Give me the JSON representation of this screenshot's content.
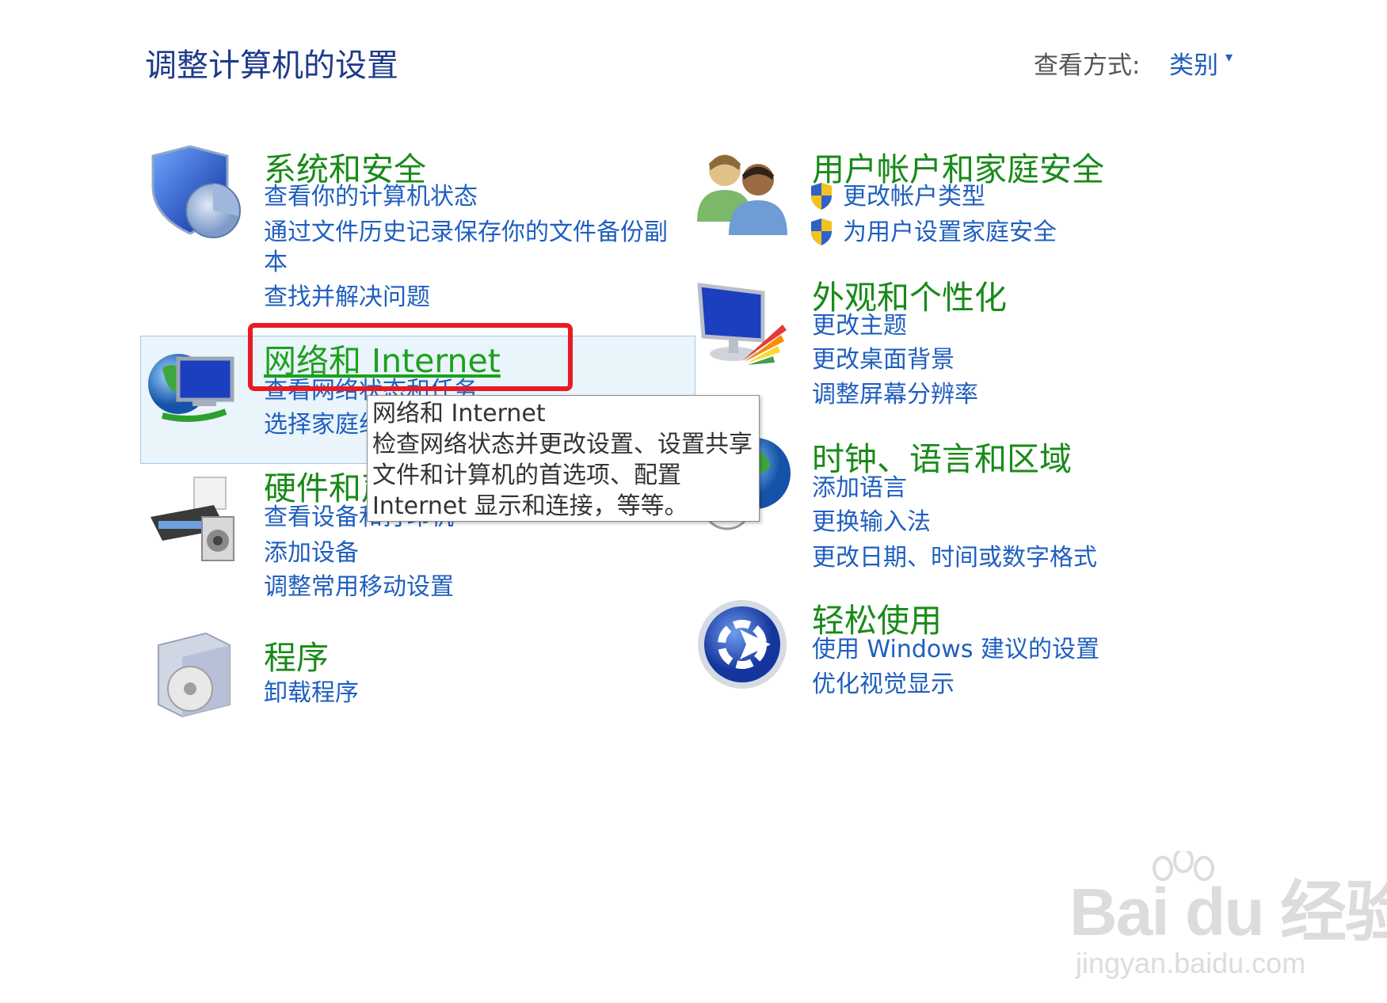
{
  "header": {
    "title": "调整计算机的设置",
    "view_label": "查看方式:",
    "view_value": "类别"
  },
  "categories": {
    "system_security": {
      "title": "系统和安全",
      "links": [
        "查看你的计算机状态",
        "通过文件历史记录保存你的文件备份副",
        "本",
        "查找并解决问题"
      ]
    },
    "network_internet": {
      "title": "网络和 Internet",
      "links": [
        "查看网络状态和任务",
        "选择家庭组"
      ]
    },
    "hardware_sound": {
      "title": "硬件和声音",
      "links": [
        "查看设备和打印机",
        "添加设备",
        "调整常用移动设置"
      ]
    },
    "programs": {
      "title": "程序",
      "links": [
        "卸载程序"
      ]
    },
    "user_accounts": {
      "title": "用户帐户和家庭安全",
      "links": [
        "更改帐户类型",
        "为用户设置家庭安全"
      ]
    },
    "appearance": {
      "title": "外观和个性化",
      "links": [
        "更改主题",
        "更改桌面背景",
        "调整屏幕分辨率"
      ]
    },
    "clock_region": {
      "title": "时钟、语言和区域",
      "links": [
        "添加语言",
        "更换输入法",
        "更改日期、时间或数字格式"
      ]
    },
    "ease_of_access": {
      "title": "轻松使用",
      "links": [
        "使用 Windows 建议的设置",
        "优化视觉显示"
      ]
    }
  },
  "tooltip": {
    "lines": [
      "网络和 Internet",
      "检查网络状态并更改设置、设置共享",
      "文件和计算机的首选项、配置",
      "Internet 显示和连接，等等。"
    ]
  },
  "watermark": {
    "brand": "Bai du 经验",
    "url": "jingyan.baidu.com"
  },
  "colors": {
    "title_blue": "#1e3a8a",
    "link_blue": "#1f5fbf",
    "category_green": "#188a18",
    "highlight_red": "#e81b25"
  }
}
